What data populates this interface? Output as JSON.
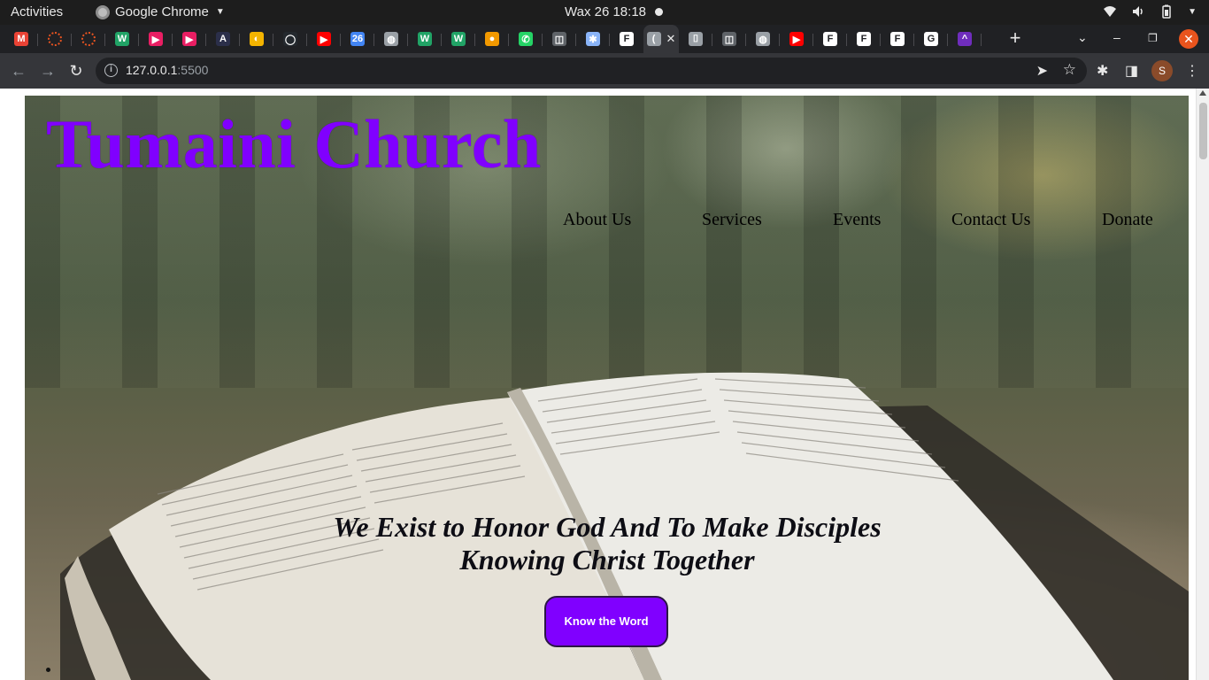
{
  "system_bar": {
    "activities": "Activities",
    "app_name": "Google Chrome",
    "clock": "Wax 26  18:18"
  },
  "tabs": [
    {
      "icon": "gmail-icon",
      "color": "#ea4335",
      "glyph": "M"
    },
    {
      "icon": "ubuntu-icon",
      "color": "#e95420",
      "glyph": ""
    },
    {
      "icon": "ubuntu-icon",
      "color": "#e95420",
      "glyph": ""
    },
    {
      "icon": "w-icon",
      "color": "#21a366",
      "glyph": "W"
    },
    {
      "icon": "media-icon",
      "color": "#e91e63",
      "glyph": "▶"
    },
    {
      "icon": "media-icon",
      "color": "#e91e63",
      "glyph": "▶"
    },
    {
      "icon": "app-icon",
      "color": "#2b2f4a",
      "glyph": "A"
    },
    {
      "icon": "colab-icon",
      "color": "#f4b400",
      "glyph": "◐"
    },
    {
      "icon": "github-icon",
      "color": "#24292e",
      "glyph": "◯"
    },
    {
      "icon": "youtube-icon",
      "color": "#ff0000",
      "glyph": "▶"
    },
    {
      "icon": "calendar-icon",
      "color": "#4285f4",
      "glyph": "26"
    },
    {
      "icon": "globe-icon",
      "color": "#9aa0a6",
      "glyph": "◍"
    },
    {
      "icon": "w-icon",
      "color": "#21a366",
      "glyph": "W"
    },
    {
      "icon": "w-icon",
      "color": "#21a366",
      "glyph": "W"
    },
    {
      "icon": "dots-icon",
      "color": "#f29900",
      "glyph": "●"
    },
    {
      "icon": "whatsapp-icon",
      "color": "#25d366",
      "glyph": "✆"
    },
    {
      "icon": "glasses-icon",
      "color": "#5f6368",
      "glyph": "◫"
    },
    {
      "icon": "puzzle-icon",
      "color": "#8ab4f8",
      "glyph": "✱"
    },
    {
      "icon": "f-icon",
      "color": "#ffffff",
      "glyph": "F"
    },
    {
      "icon": "active-tab-icon",
      "color": "#9aa0a6",
      "glyph": "("
    },
    {
      "icon": "box-icon",
      "color": "#9aa0a6",
      "glyph": "⌷"
    },
    {
      "icon": "glasses-icon",
      "color": "#5f6368",
      "glyph": "◫"
    },
    {
      "icon": "globe-icon",
      "color": "#9aa0a6",
      "glyph": "◍"
    },
    {
      "icon": "youtube-icon",
      "color": "#ff0000",
      "glyph": "▶"
    },
    {
      "icon": "f-icon",
      "color": "#ffffff",
      "glyph": "F"
    },
    {
      "icon": "f-icon",
      "color": "#ffffff",
      "glyph": "F"
    },
    {
      "icon": "f-icon",
      "color": "#ffffff",
      "glyph": "F"
    },
    {
      "icon": "google-icon",
      "color": "#ffffff",
      "glyph": "G"
    },
    {
      "icon": "app-icon",
      "color": "#6f2dbd",
      "glyph": "^"
    }
  ],
  "toolbar": {
    "url_host": "127.0.0.1",
    "url_port": ":5500",
    "profile_initial": "S"
  },
  "page": {
    "site_title": "Tumaini Church",
    "nav": [
      "About Us",
      "Services",
      "Events",
      "Contact Us",
      "Donate"
    ],
    "tagline_line1": "We Exist to Honor God And To Make Disciples",
    "tagline_line2": "Knowing Christ Together",
    "cta_label": "Know the Word",
    "accent_color": "#8000ff"
  }
}
